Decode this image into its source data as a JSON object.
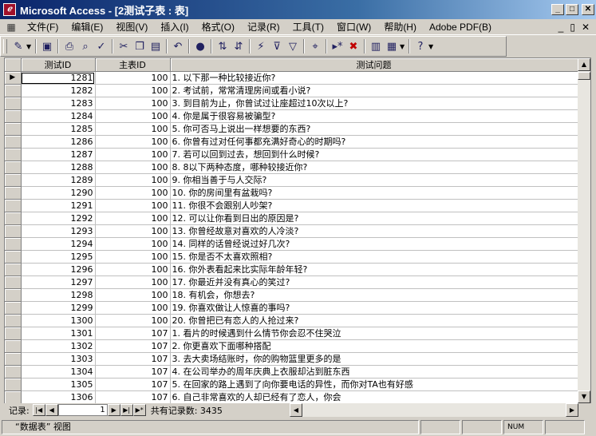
{
  "window": {
    "title": "Microsoft Access - [2测试子表 : 表]",
    "app_icon": "access-key-icon",
    "minimize": "_",
    "restore": "□",
    "close": "✕"
  },
  "menu": {
    "items": [
      "文件(F)",
      "编辑(E)",
      "视图(V)",
      "插入(I)",
      "格式(O)",
      "记录(R)",
      "工具(T)",
      "窗口(W)",
      "帮助(H)",
      "Adobe PDF(B)"
    ],
    "child_minimize": "_",
    "child_restore": "▯",
    "child_close": "✕"
  },
  "toolbar": {
    "icons": [
      "design-view-icon",
      "save-icon",
      "print-icon",
      "print-preview-icon",
      "spelling-icon",
      "cut-icon",
      "copy-icon",
      "paste-icon",
      "undo-icon",
      "insert-object-icon",
      "sort-ascending-icon",
      "sort-descending-icon",
      "filter-by-selection-icon",
      "filter-by-form-icon",
      "apply-filter-icon",
      "find-icon",
      "new-record-icon",
      "delete-record-icon",
      "database-window-icon",
      "new-object-icon",
      "help-icon"
    ]
  },
  "grid": {
    "columns": [
      "测试ID",
      "主表ID",
      "测试问题"
    ],
    "current_row_indicator": "▶",
    "rows": [
      [
        "1281",
        "100",
        "1.  以下那一种比较接近你?"
      ],
      [
        "1282",
        "100",
        "2.  考试前，常常清理房间或看小说?"
      ],
      [
        "1283",
        "100",
        "3.  到目前为止，你曾试过让座超过10次以上?"
      ],
      [
        "1284",
        "100",
        "4.  你是属于很容易被骗型?"
      ],
      [
        "1285",
        "100",
        "5.  你可否马上说出一样想要的东西?"
      ],
      [
        "1286",
        "100",
        "6.  你曾有过对任何事都充满好奇心的时期吗?"
      ],
      [
        "1287",
        "100",
        "7.  若可以回到过去，想回到什么时候?"
      ],
      [
        "1288",
        "100",
        "8.  8以下两种态度，哪种较接近你?"
      ],
      [
        "1289",
        "100",
        "9.  你相当善于与人交际?"
      ],
      [
        "1290",
        "100",
        "10.  你的房间里有盆栽吗?"
      ],
      [
        "1291",
        "100",
        "11.  你很不会跟别人吵架?"
      ],
      [
        "1292",
        "100",
        "12.  可以让你看到日出的原因是?"
      ],
      [
        "1293",
        "100",
        "13.  你曾经故意对喜欢的人冷淡?"
      ],
      [
        "1294",
        "100",
        "14.  同样的话曾经说过好几次?"
      ],
      [
        "1295",
        "100",
        "15.  你是否不太喜欢照相?"
      ],
      [
        "1296",
        "100",
        "16.  你外表看起来比实际年龄年轻?"
      ],
      [
        "1297",
        "100",
        "17.  你最近并没有真心的笑过?"
      ],
      [
        "1298",
        "100",
        "18.  有机会，你想去?"
      ],
      [
        "1299",
        "100",
        "19.  你喜欢做让人惊喜的事吗?"
      ],
      [
        "1300",
        "100",
        "20.  你曾把已有恋人的人抢过来?"
      ],
      [
        "1301",
        "107",
        "1.  看片的时候遇到什么情节你会忍不住哭泣"
      ],
      [
        "1302",
        "107",
        "2.  你更喜欢下面哪种搭配"
      ],
      [
        "1303",
        "107",
        "3.  去大卖场结账时，你的购物篮里更多的是"
      ],
      [
        "1304",
        "107",
        "4.  在公司举办的周年庆典上衣服却沾到脏东西"
      ],
      [
        "1305",
        "107",
        "5.  在回家的路上遇到了向你要电话的异性，而你对TA也有好感"
      ],
      [
        "1306",
        "107",
        "6.  自己非常喜欢的人却已经有了恋人，你会"
      ]
    ]
  },
  "navigation": {
    "label": "记录:",
    "current": "1",
    "count_text": "共有记录数: 3435",
    "first": "|◀",
    "prev": "◀",
    "next": "▶",
    "last": "▶|",
    "new": "▶*"
  },
  "status": {
    "view": "“数据表” 视图",
    "num": "NUM"
  }
}
